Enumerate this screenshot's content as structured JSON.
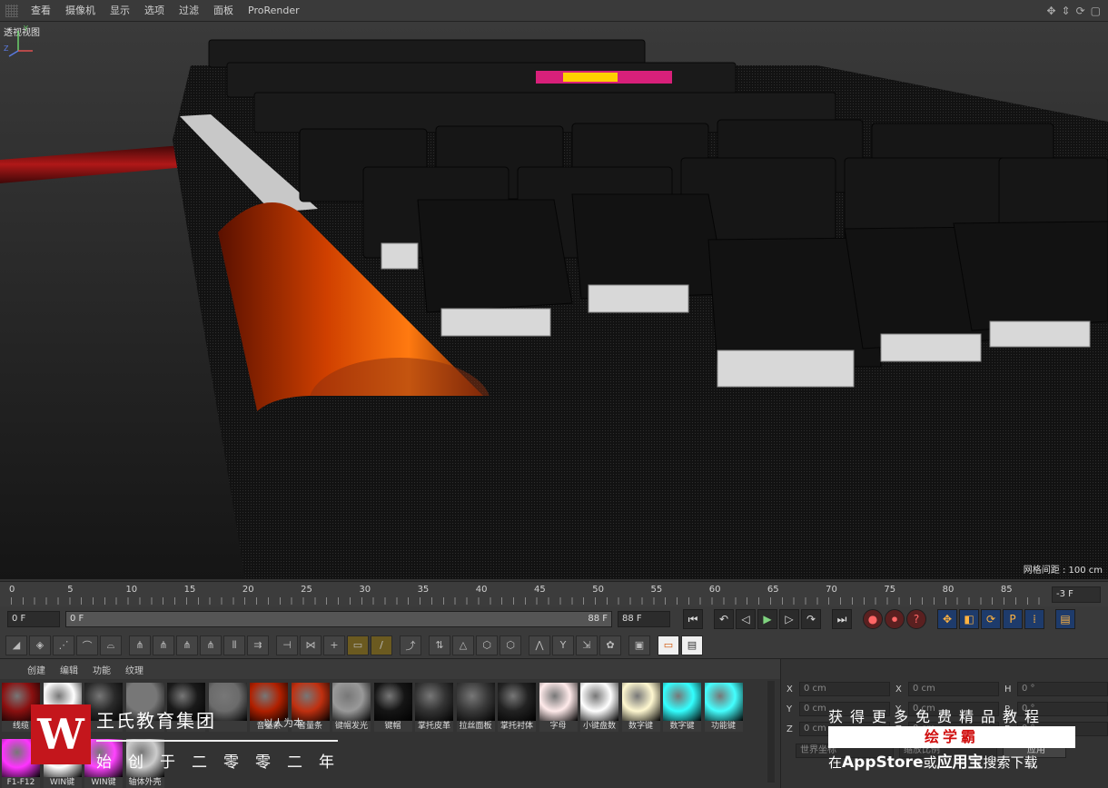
{
  "menu": {
    "items": [
      "查看",
      "摄像机",
      "显示",
      "选项",
      "过滤",
      "面板",
      "ProRender"
    ]
  },
  "viewport": {
    "title": "透视视图",
    "grid_spacing": "网格间距 : 100 cm",
    "axis_labels": {
      "x": "X",
      "y": "Y",
      "z": "Z"
    }
  },
  "timeline": {
    "ticks": [
      "0",
      "5",
      "10",
      "15",
      "20",
      "25",
      "30",
      "35",
      "40",
      "45",
      "50",
      "55",
      "60",
      "65",
      "70",
      "75",
      "80",
      "85"
    ],
    "frame_end_field": "-3 F"
  },
  "transport": {
    "current_frame": "0 F",
    "range_start": "0 F",
    "range_end": "88 F",
    "max_frame": "88 F"
  },
  "material_manager": {
    "tabs": [
      "创建",
      "编辑",
      "功能",
      "纹理"
    ],
    "materials": [
      {
        "label": "线缆",
        "color": "#8a1010"
      },
      {
        "label": "背面",
        "color": "#ffffff"
      },
      {
        "label": "",
        "color": "#2a2a2a"
      },
      {
        "label": "",
        "color": "#777777"
      },
      {
        "label": "",
        "color": "#1a1a1a"
      },
      {
        "label": "",
        "color": "#6b6b6b"
      },
      {
        "label": "音量条",
        "color": "#b02000"
      },
      {
        "label": "音量条",
        "color": "#c03010"
      },
      {
        "label": "键帽发光",
        "color": "#999999"
      },
      {
        "label": "键帽",
        "color": "#151515"
      },
      {
        "label": "掌托皮革",
        "color": "#333333"
      },
      {
        "label": "拉丝面板",
        "color": "#3a3a3a"
      },
      {
        "label": "掌托衬体",
        "color": "#222222"
      },
      {
        "label": "字母",
        "color": "#ffeaea"
      },
      {
        "label": "小键盘数",
        "color": "#ffffff"
      },
      {
        "label": "数字键",
        "color": "#fff8d0"
      },
      {
        "label": "数字键",
        "color": "#33ffff"
      },
      {
        "label": "功能键",
        "color": "#44ffff"
      },
      {
        "label": "F1-F12",
        "color": "#ff33ff"
      },
      {
        "label": "WIN键",
        "color": "#ffffff"
      },
      {
        "label": "WIN键",
        "color": "#ff44ff"
      },
      {
        "label": "轴体外壳",
        "color": "#cccccc"
      }
    ]
  },
  "coordinates": {
    "x_pos": "0 cm",
    "x_size": "0 cm",
    "h_rot": "0 °",
    "y_pos": "0 cm",
    "y_size": "0 cm",
    "p_rot": "0 °",
    "z_pos": "0 cm",
    "z_size": "0 cm",
    "b_rot": "0 °",
    "coord_system": "世界坐标",
    "size_mode": "缩放比例",
    "apply_button": "应用"
  },
  "watermark": {
    "logo_letter": "W",
    "company": "王氏教育集团",
    "company_sub": "以人为本",
    "founded": "始创于二零零二年",
    "promo": "获得更多免费精品教程",
    "brand": "绘学霸",
    "store_prefix": "在",
    "store_appstore": "AppStore",
    "store_or": "或",
    "store_yyb": "应用宝",
    "store_suffix": "搜索下载"
  },
  "colors": {
    "accent_orange": "#ffb340",
    "play_green": "#7fd37f",
    "brand_red": "#c4161c"
  }
}
